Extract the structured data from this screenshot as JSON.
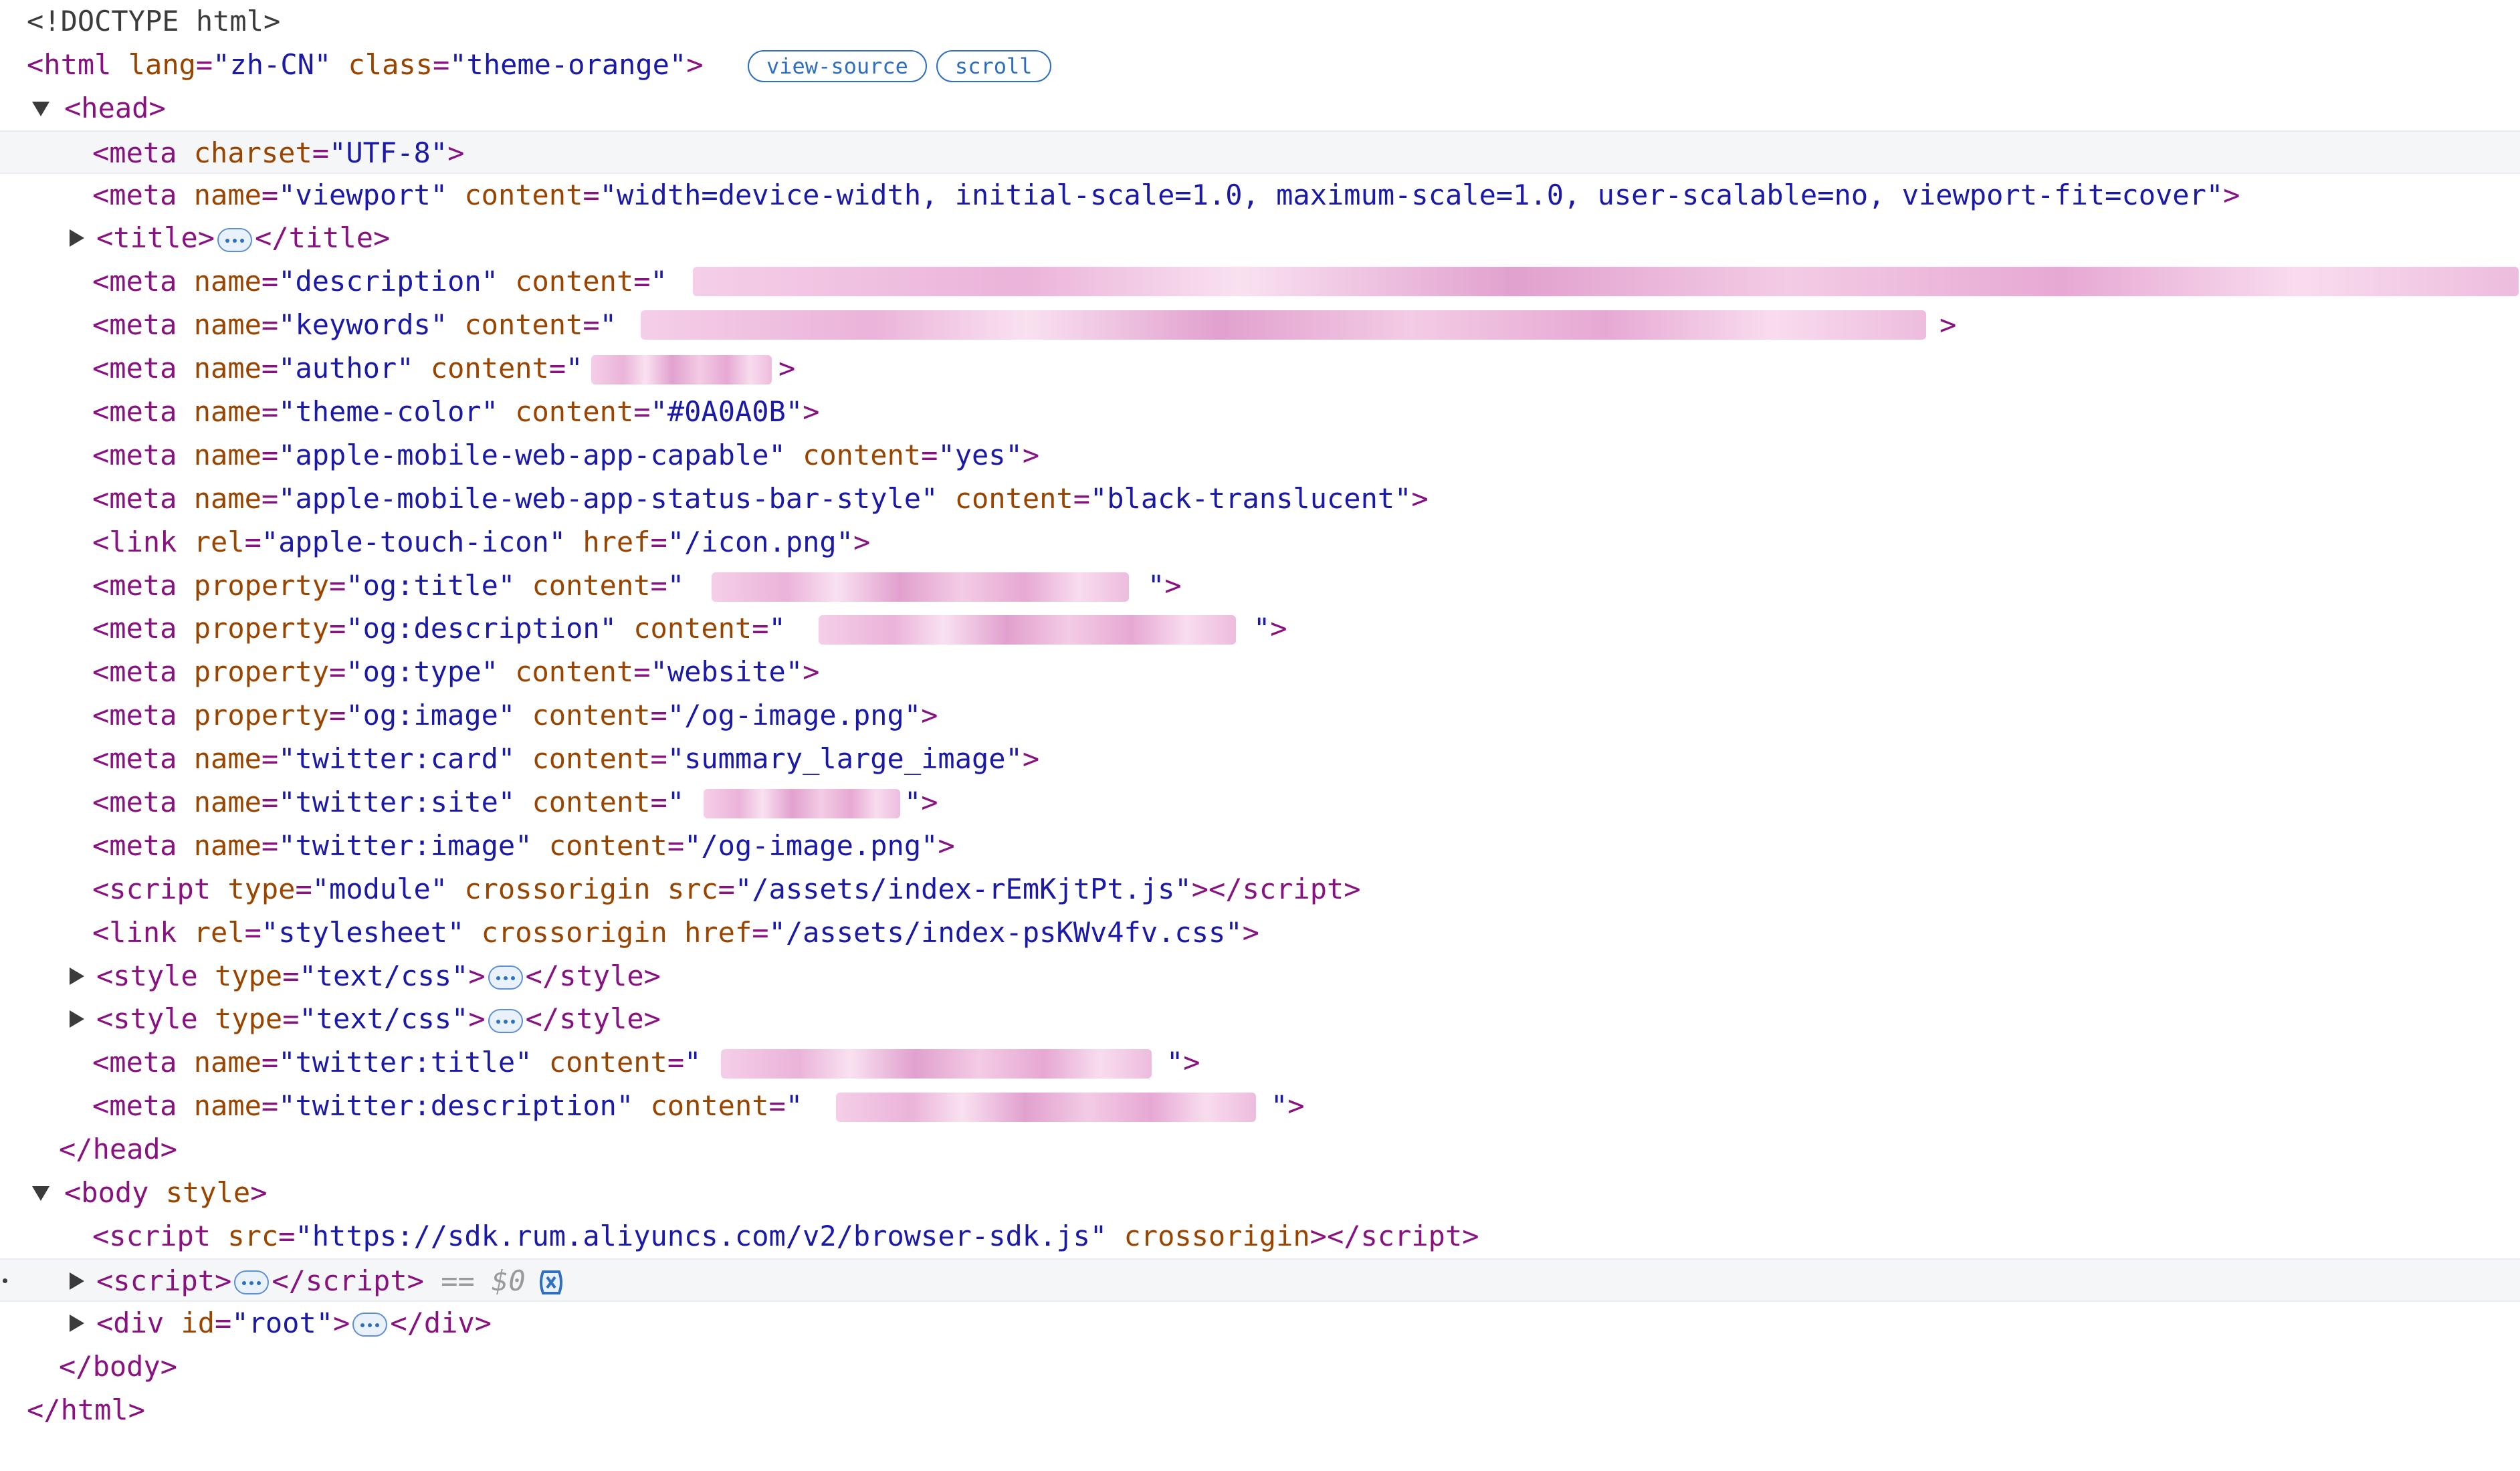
{
  "lines": {
    "doctype": "<!DOCTYPE html>",
    "html_tag": "html",
    "html_lang_attr": "lang",
    "html_lang_val": "\"zh-CN\"",
    "html_class_attr": "class",
    "html_class_val": "\"theme-orange\"",
    "badge_view_source": "view-source",
    "badge_scroll": "scroll",
    "head_tag": "head",
    "meta": "meta",
    "link": "link",
    "title": "title",
    "script": "script",
    "style": "style",
    "body": "body",
    "div": "div",
    "charset_attr": "charset",
    "charset_val": "\"UTF-8\"",
    "name_attr": "name",
    "content_attr": "content",
    "property_attr": "property",
    "rel_attr": "rel",
    "href_attr": "href",
    "type_attr": "type",
    "src_attr": "src",
    "crossorigin_attr": "crossorigin",
    "id_attr": "id",
    "viewport_name": "\"viewport\"",
    "viewport_content": "\"width=device-width, initial-scale=1.0, maximum-scale=1.0, user-scalable=no, viewport-fit=cover\"",
    "description_name": "\"description\"",
    "keywords_name": "\"keywords\"",
    "author_name": "\"author\"",
    "theme_color_name": "\"theme-color\"",
    "theme_color_content": "\"#0A0A0B\"",
    "apple_capable_name": "\"apple-mobile-web-app-capable\"",
    "apple_capable_content": "\"yes\"",
    "apple_status_name": "\"apple-mobile-web-app-status-bar-style\"",
    "apple_status_content": "\"black-translucent\"",
    "apple_icon_rel": "\"apple-touch-icon\"",
    "apple_icon_href": "\"/icon.png\"",
    "og_title_prop": "\"og:title\"",
    "og_desc_prop": "\"og:description\"",
    "og_type_prop": "\"og:type\"",
    "og_type_content": "\"website\"",
    "og_image_prop": "\"og:image\"",
    "og_image_content": "\"/og-image.png\"",
    "tw_card_name": "\"twitter:card\"",
    "tw_card_content": "\"summary_large_image\"",
    "tw_site_name": "\"twitter:site\"",
    "tw_image_name": "\"twitter:image\"",
    "tw_image_content": "\"/og-image.png\"",
    "script_type_val": "\"module\"",
    "script_src_val": "\"/assets/index-rEmKjtPt.js\"",
    "stylesheet_rel": "\"stylesheet\"",
    "stylesheet_href": "\"/assets/index-psKWv4fv.css\"",
    "style_type_val": "\"text/css\"",
    "tw_title_name": "\"twitter:title\"",
    "tw_desc_name": "\"twitter:description\"",
    "body_style_attr": "style",
    "sdk_src_val": "\"https://sdk.rum.aliyuncs.com/v2/browser-sdk.js\"",
    "dollar_zero": "== $0",
    "root_id_val": "\"root\""
  },
  "colors": {
    "tag": "#881280",
    "attr": "#994500",
    "value": "#1a1aa6",
    "badge": "#2f6fbf",
    "blur": "#e7a6d3"
  },
  "icons": [
    "triangle-expanded-icon",
    "triangle-collapsed-icon",
    "ellipsis-icon",
    "console-icon"
  ]
}
